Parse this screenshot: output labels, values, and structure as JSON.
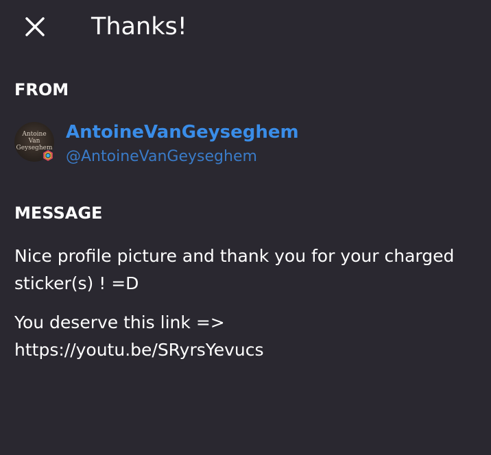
{
  "header": {
    "close_icon": "close-icon",
    "title": "Thanks!"
  },
  "from": {
    "label": "FROM",
    "avatar": {
      "line1": "Antoine",
      "line2": "Van",
      "line3": "Geyseghem",
      "badge_icon": "hexagon-badge-icon"
    },
    "display_name": "AntoineVanGeyseghem",
    "handle": "@AntoineVanGeyseghem"
  },
  "message": {
    "label": "MESSAGE",
    "paragraphs": [
      "Nice profile picture and thank you for your charged sticker(s) ! =D",
      "You deserve this link => https://youtu.be/SRyrsYevucs"
    ]
  },
  "colors": {
    "background": "#2a2830",
    "text": "#ffffff",
    "link_blue": "#3a8de8",
    "handle_blue": "#3a7bc8"
  }
}
